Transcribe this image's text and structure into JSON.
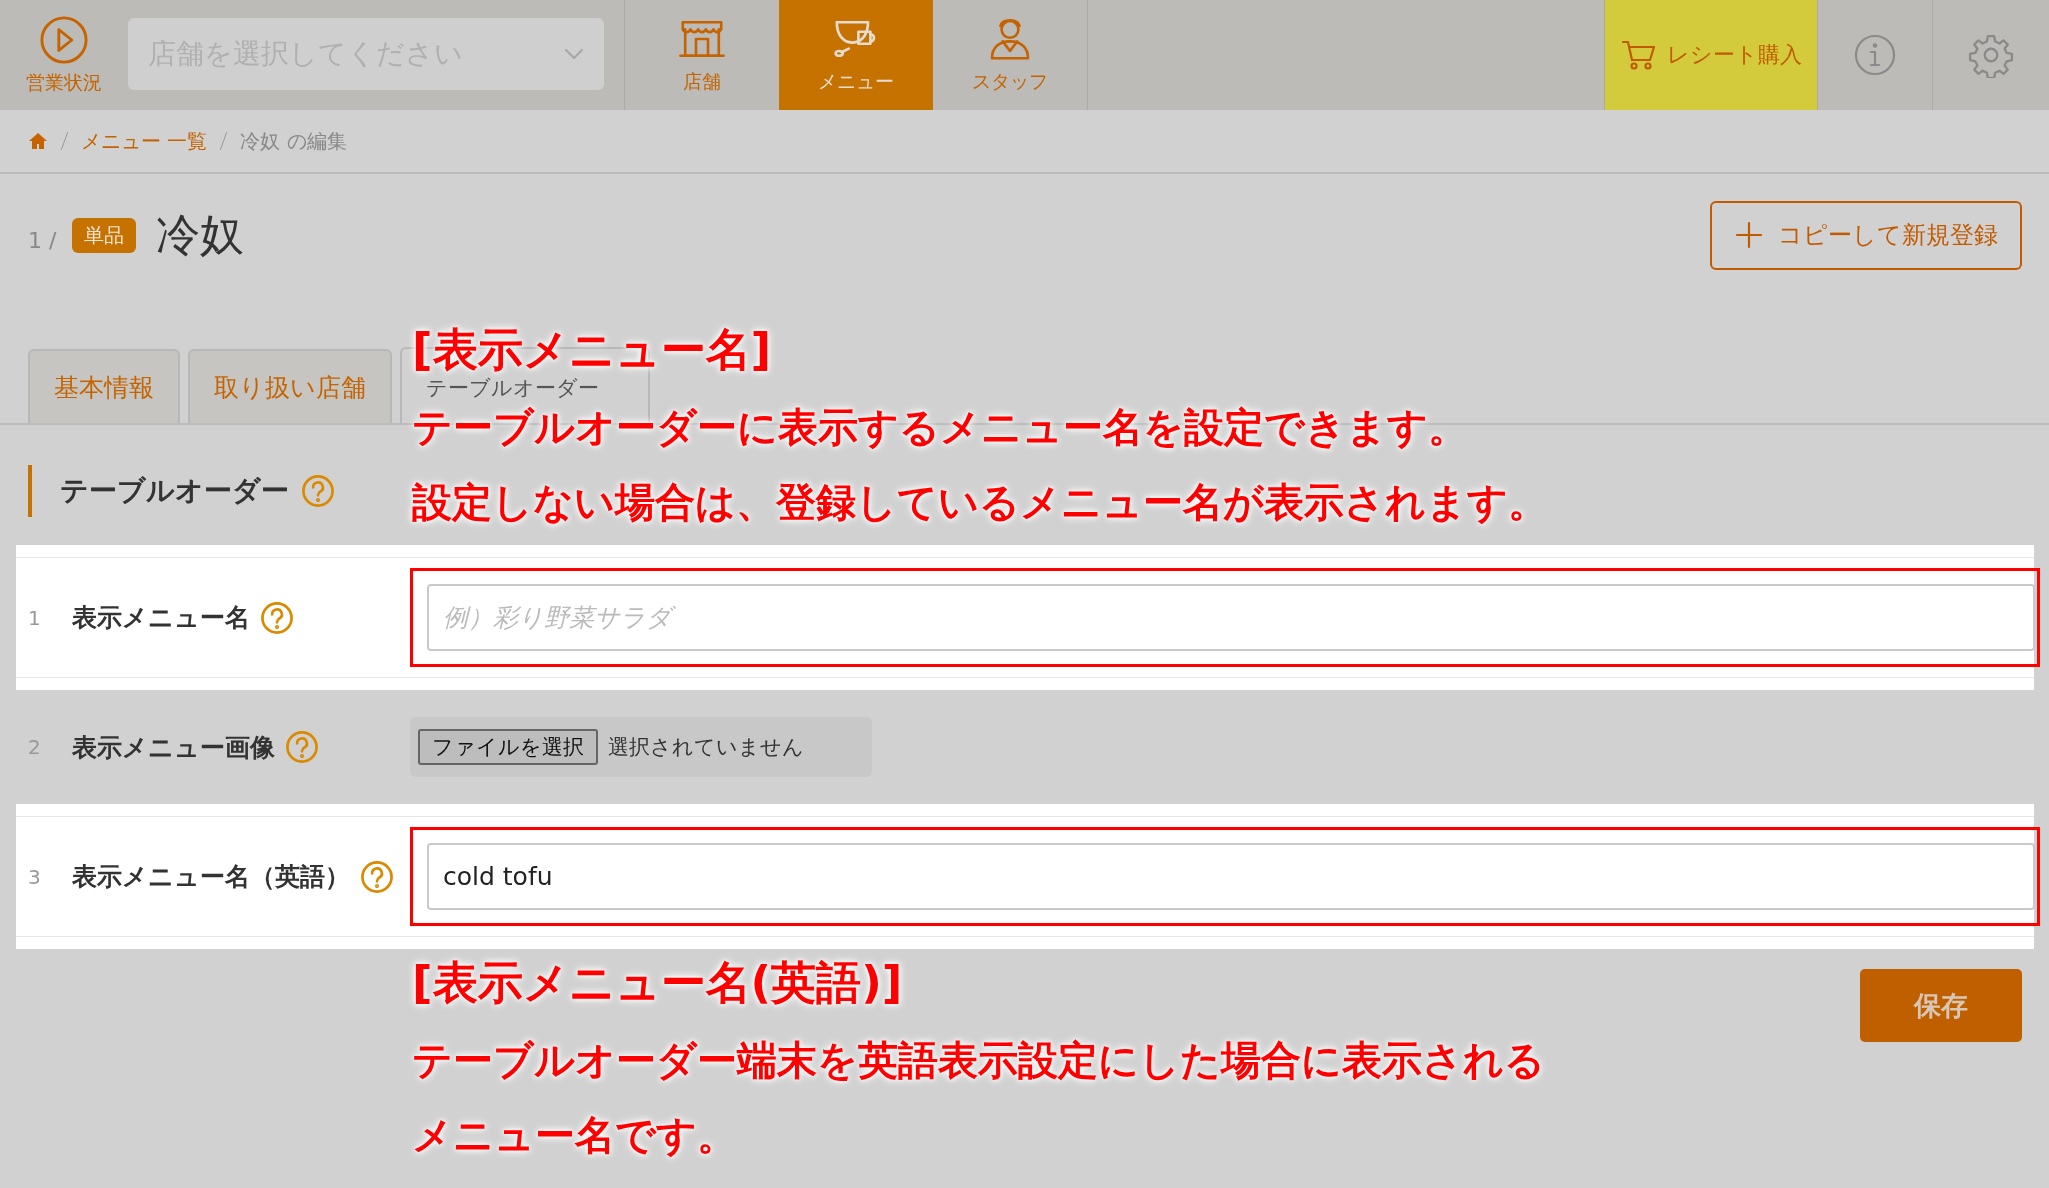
{
  "top_bar": {
    "status": {
      "label": "営業状況"
    },
    "store_select": {
      "placeholder": "店舗を選択してください"
    },
    "nav": [
      {
        "kind": "store",
        "label": "店舗",
        "selected": false
      },
      {
        "kind": "menu",
        "label": "メニュー",
        "selected": true
      },
      {
        "kind": "staff",
        "label": "スタッフ",
        "selected": false
      }
    ],
    "receipt_button": {
      "label": "レシート購入"
    }
  },
  "breadcrumb": [
    {
      "label": "メニュー 一覧",
      "current": false
    },
    {
      "label": "冷奴 の編集",
      "current": true
    }
  ],
  "header": {
    "index": "1 /",
    "badge": "単品",
    "title": "冷奴",
    "copy_button": "コピーして新規登録"
  },
  "tabs": [
    {
      "label": "基本情報",
      "selected": false
    },
    {
      "label": "取り扱い店舗",
      "selected": false
    },
    {
      "label": "テーブルオーダー",
      "selected": true
    }
  ],
  "section": {
    "title": "テーブルオーダー"
  },
  "fields": [
    {
      "number": "1",
      "label": "表示メニュー名",
      "kind": "text",
      "placeholder": "例）彩り野菜サラダ",
      "highlighted": true
    },
    {
      "number": "2",
      "label": "表示メニュー画像",
      "kind": "file",
      "button": "ファイルを選択",
      "status": "選択されていません",
      "highlighted": false
    },
    {
      "number": "3",
      "label": "表示メニュー名（英語）",
      "kind": "text",
      "value": "cold tofu",
      "highlighted": true
    }
  ],
  "save_button": "保存",
  "annotations": [
    {
      "title": "[表示メニュー名]",
      "lines": [
        "テーブルオーダーに表示するメニュー名を設定できます。",
        "設定しない場合は、登録しているメニュー名が表示されます。"
      ]
    },
    {
      "title": "[表示メニュー名(英語)]",
      "lines": [
        "テーブルオーダー端末を英語表示設定にした場合に表示される",
        "メニュー名です。"
      ]
    }
  ]
}
